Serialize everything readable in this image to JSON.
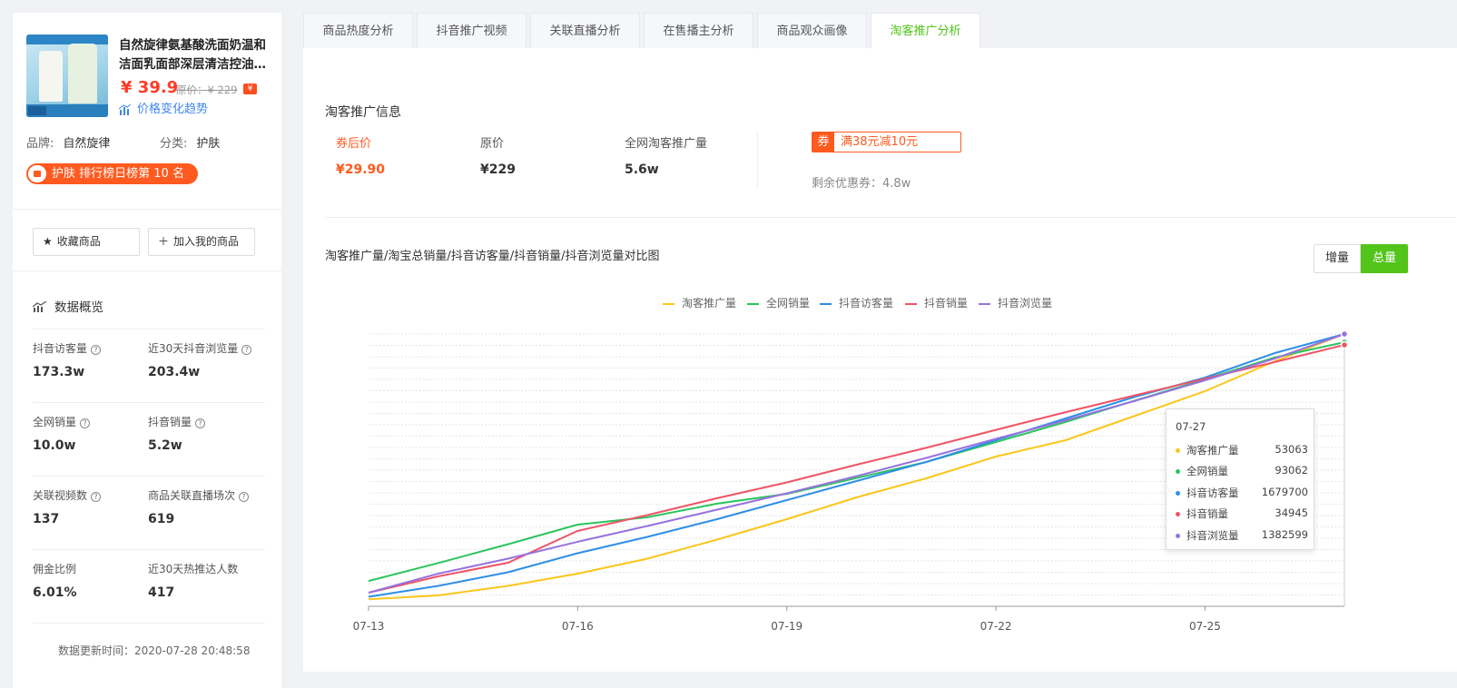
{
  "product": {
    "title": "自然旋律氨基酸洗面奶温和洁面乳面部深层清洁控油…",
    "price": "¥ 39.9",
    "original_price": "原价：¥ 229",
    "price_trend": "价格变化趋势",
    "brand_label": "品牌:",
    "brand": "自然旋律",
    "category_label": "分类:",
    "category": "护肤",
    "rank_badge": "护肤 排行榜日榜第 10 名"
  },
  "actions": {
    "favorite": "收藏商品",
    "add": "加入我的商品"
  },
  "overview": {
    "title": "数据概览",
    "stats": [
      {
        "label": "抖音访客量",
        "value": "173.3w",
        "help": true
      },
      {
        "label": "近30天抖音浏览量",
        "value": "203.4w",
        "help": true
      },
      {
        "label": "全网销量",
        "value": "10.0w",
        "help": true
      },
      {
        "label": "抖音销量",
        "value": "5.2w",
        "help": true
      },
      {
        "label": "关联视频数",
        "value": "137",
        "help": true
      },
      {
        "label": "商品关联直播场次",
        "value": "619",
        "help": true
      },
      {
        "label": "佣金比例",
        "value": "6.01%",
        "help": false
      },
      {
        "label": "近30天热推达人数",
        "value": "417",
        "help": false
      }
    ],
    "updated": "数据更新时间：2020-07-28 20:48:58"
  },
  "tabs": [
    "商品热度分析",
    "抖音推广视频",
    "关联直播分析",
    "在售播主分析",
    "商品观众画像",
    "淘客推广分析"
  ],
  "active_tab": "淘客推广分析",
  "taoke": {
    "section_title": "淘客推广信息",
    "after_coupon_label": "券后价",
    "after_coupon_value": "¥29.90",
    "orig_label": "原价",
    "orig_value": "¥229",
    "promo_label": "全网淘客推广量",
    "promo_value": "5.6w",
    "coupon_tag": "券",
    "coupon_text": "满38元减10元",
    "coupons_left": "剩余优惠券：4.8w"
  },
  "chart_toggle": {
    "increment": "增量",
    "total": "总量",
    "active": "总量"
  },
  "colors": {
    "accent": "#52c41a",
    "orange": "#ff5a1f",
    "price_red": "#ff3b25",
    "link_blue": "#3f86f0"
  },
  "chart_data": {
    "type": "line",
    "title": "淘客推广量/淘宝总销量/抖音访客量/抖音销量/抖音浏览量对比图",
    "x": [
      "07-13",
      "07-14",
      "07-15",
      "07-16",
      "07-17",
      "07-18",
      "07-19",
      "07-20",
      "07-21",
      "07-22",
      "07-23",
      "07-24",
      "07-25",
      "07-26",
      "07-27"
    ],
    "tick_labels": [
      "07-13",
      "07-16",
      "07-19",
      "07-22",
      "07-25"
    ],
    "legend_position": "top-center",
    "grid": true,
    "series": [
      {
        "name": "淘客推广量",
        "color": "#fac61a",
        "rel": [
          0.026,
          0.04,
          0.075,
          0.12,
          0.175,
          0.245,
          0.32,
          0.4,
          0.47,
          0.55,
          0.61,
          0.7,
          0.79,
          0.9,
          1.0
        ]
      },
      {
        "name": "全网销量",
        "color": "#2bc45e",
        "rel": [
          0.093,
          0.159,
          0.228,
          0.3,
          0.327,
          0.377,
          0.413,
          0.471,
          0.53,
          0.603,
          0.677,
          0.756,
          0.834,
          0.914,
          0.97
        ]
      },
      {
        "name": "抖音访客量",
        "color": "#2e8fe6",
        "rel": [
          0.035,
          0.075,
          0.125,
          0.195,
          0.255,
          0.32,
          0.39,
          0.46,
          0.53,
          0.61,
          0.69,
          0.77,
          0.84,
          0.93,
          1.0
        ]
      },
      {
        "name": "抖音销量",
        "color": "#ef5466",
        "rel": [
          0.05,
          0.11,
          0.16,
          0.277,
          0.335,
          0.397,
          0.455,
          0.52,
          0.582,
          0.648,
          0.713,
          0.775,
          0.836,
          0.897,
          0.96
        ]
      },
      {
        "name": "抖音浏览量",
        "color": "#9772df",
        "rel": [
          0.05,
          0.12,
          0.175,
          0.237,
          0.295,
          0.355,
          0.415,
          0.478,
          0.545,
          0.615,
          0.683,
          0.755,
          0.83,
          0.91,
          1.0
        ]
      }
    ],
    "tooltip": {
      "date": "07-27",
      "rows": [
        {
          "name": "淘客推广量",
          "value": "53063"
        },
        {
          "name": "全网销量",
          "value": "93062"
        },
        {
          "name": "抖音访客量",
          "value": "1679700"
        },
        {
          "name": "抖音销量",
          "value": "34945"
        },
        {
          "name": "抖音浏览量",
          "value": "1382599"
        }
      ]
    }
  }
}
